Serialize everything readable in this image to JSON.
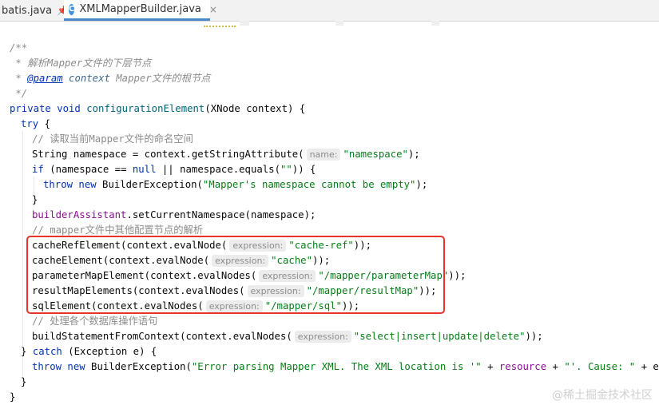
{
  "tabs": [
    {
      "label": "batis.java",
      "pinned": true
    },
    {
      "label": "XMLMapperBuilder.java",
      "active": true
    }
  ],
  "tab_icon_letter": "C",
  "pin_icon": "📌",
  "close_icon": "×",
  "code": {
    "l1": "/**",
    "l2_star": " * ",
    "l2": "解析Mapper文件的下层节点",
    "l3_star": " * ",
    "l3_tag": "@param",
    "l3_param": "context",
    "l3_rest": " Mapper文件的根节点",
    "l4": " */",
    "l5_kw": "private void",
    "l5_fn": "configurationElement",
    "l5_rest": "(XNode context) {",
    "l6_kw": "try",
    "l6_rest": " {",
    "l7": "// 读取当前Mapper文件的命名空间",
    "l8_a": "String namespace = context.getStringAttribute(",
    "l8_hint": "name:",
    "l8_str": "\"namespace\"",
    "l8_b": ");",
    "l9_kw": "if",
    "l9_a": " (namespace == ",
    "l9_null": "null",
    "l9_b": " || namespace.equals(",
    "l9_str": "\"\"",
    "l9_c": ")) {",
    "l10_kw": "throw new",
    "l10_a": " BuilderException(",
    "l10_str": "\"Mapper's namespace cannot be empty\"",
    "l10_b": ");",
    "l11": "}",
    "l12_fld": "builderAssistant",
    "l12_rest": ".setCurrentNamespace(namespace);",
    "l13": "// mapper文件中其他配置节点的解析",
    "l14_a": "cacheRefElement(context.evalNode(",
    "l14_hint": "expression:",
    "l14_str": "\"cache-ref\"",
    "l14_b": "));",
    "l15_a": "cacheElement(context.evalNode(",
    "l15_hint": "expression:",
    "l15_str": "\"cache\"",
    "l15_b": "));",
    "l16_a": "parameterMapElement(context.evalNodes(",
    "l16_hint": "expression:",
    "l16_str": "\"/mapper/parameterMap\"",
    "l16_b": "));",
    "l17_a": "resultMapElements(context.evalNodes(",
    "l17_hint": "expression:",
    "l17_str": "\"/mapper/resultMap\"",
    "l17_b": "));",
    "l18_a": "sqlElement(context.evalNodes(",
    "l18_hint": "expression:",
    "l18_str": "\"/mapper/sql\"",
    "l18_b": "));",
    "l19": "// 处理各个数据库操作语句",
    "l20_a": "buildStatementFromContext(context.evalNodes(",
    "l20_hint": "expression:",
    "l20_str": "\"select|insert|update|delete\"",
    "l20_b": "));",
    "l21_a": "} ",
    "l21_kw": "catch",
    "l21_b": " (Exception e) {",
    "l22_kw": "throw new",
    "l22_a": " BuilderException(",
    "l22_str": "\"Error parsing Mapper XML. The XML location is '\"",
    "l22_b": " + ",
    "l22_fld": "resource",
    "l22_c": " + ",
    "l22_str2": "\"'. Cause: \"",
    "l22_d": " + e, e);",
    "l23": "}",
    "l24": "}"
  },
  "watermark": "@稀土掘金技术社区",
  "colors": {
    "keyword": "#0033b3",
    "string": "#067d17",
    "comment": "#8c8c8c",
    "method": "#00627a",
    "field": "#871094",
    "highlight_box": "#e8322e",
    "active_tab": "#4a88c7"
  }
}
